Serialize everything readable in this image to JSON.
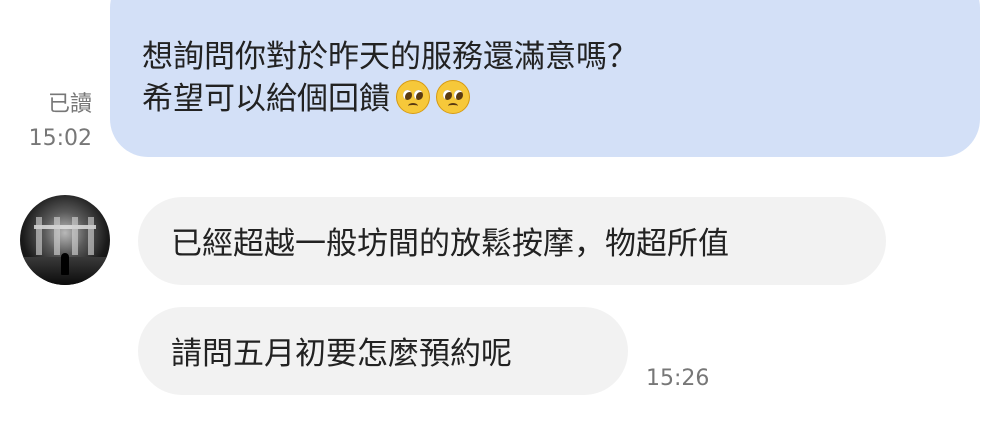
{
  "outgoing_message": {
    "line1": "想詢問你對於昨天的服務還滿意嗎？",
    "line2": "希望可以給個回饋",
    "emojis": [
      "pleading-face-icon",
      "pleading-face-icon"
    ],
    "bubble_color": "#d3e0f7"
  },
  "outgoing_meta": {
    "read_label": "已讀",
    "time": "15:02"
  },
  "incoming_messages": [
    {
      "text": "已經超越一般坊間的放鬆按摩，物超所值"
    },
    {
      "text": "請問五月初要怎麼預約呢"
    }
  ],
  "incoming_meta": {
    "time": "15:26",
    "bubble_color": "#f2f2f2"
  }
}
